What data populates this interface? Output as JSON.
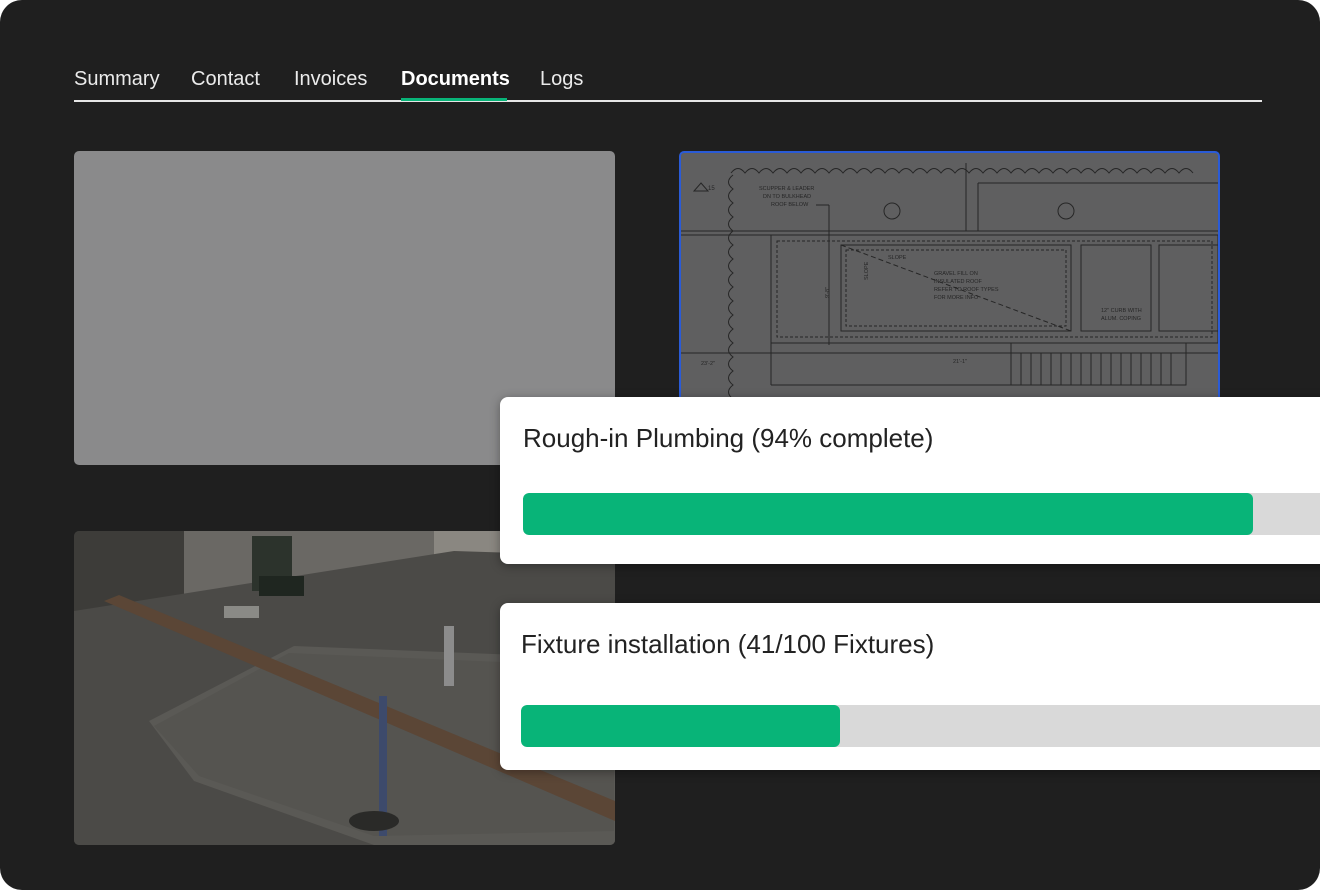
{
  "tabs": [
    {
      "label": "Summary",
      "active": false
    },
    {
      "label": "Contact",
      "active": false
    },
    {
      "label": "Invoices",
      "active": false
    },
    {
      "label": "Documents",
      "active": true
    },
    {
      "label": "Logs",
      "active": false
    }
  ],
  "colors": {
    "accent": "#08b478",
    "background": "#1f1f1f",
    "track": "#d9d9d9",
    "selection_border": "#2a5bd7"
  },
  "documents": [
    {
      "kind": "blank-placeholder"
    },
    {
      "kind": "architectural-plan",
      "labels": {
        "scupper": [
          "SCUPPER & LEADER",
          "DN TO BULKHEAD",
          "ROOF BELOW"
        ],
        "gravel": [
          "GRAVEL FILL ON",
          "INSULATED ROOF",
          "REFER TO ROOF TYPES",
          "FOR MORE INFO"
        ],
        "curb": [
          "12\" CURB WITH",
          "ALUM. COPING"
        ],
        "slope_1": "SLOPE",
        "slope_2": "SLOPE",
        "dim_left": "23'-2\"",
        "dim_mid": "21'-1\"",
        "dim_vert": "9'-8\"",
        "rev": "15"
      }
    },
    {
      "kind": "job-site-photo"
    }
  ],
  "progress": [
    {
      "title": "Rough-in Plumbing (94% complete)",
      "fraction": 0.94
    },
    {
      "title": "Fixture installation (41/100 Fixtures)",
      "fraction": 0.41
    }
  ]
}
